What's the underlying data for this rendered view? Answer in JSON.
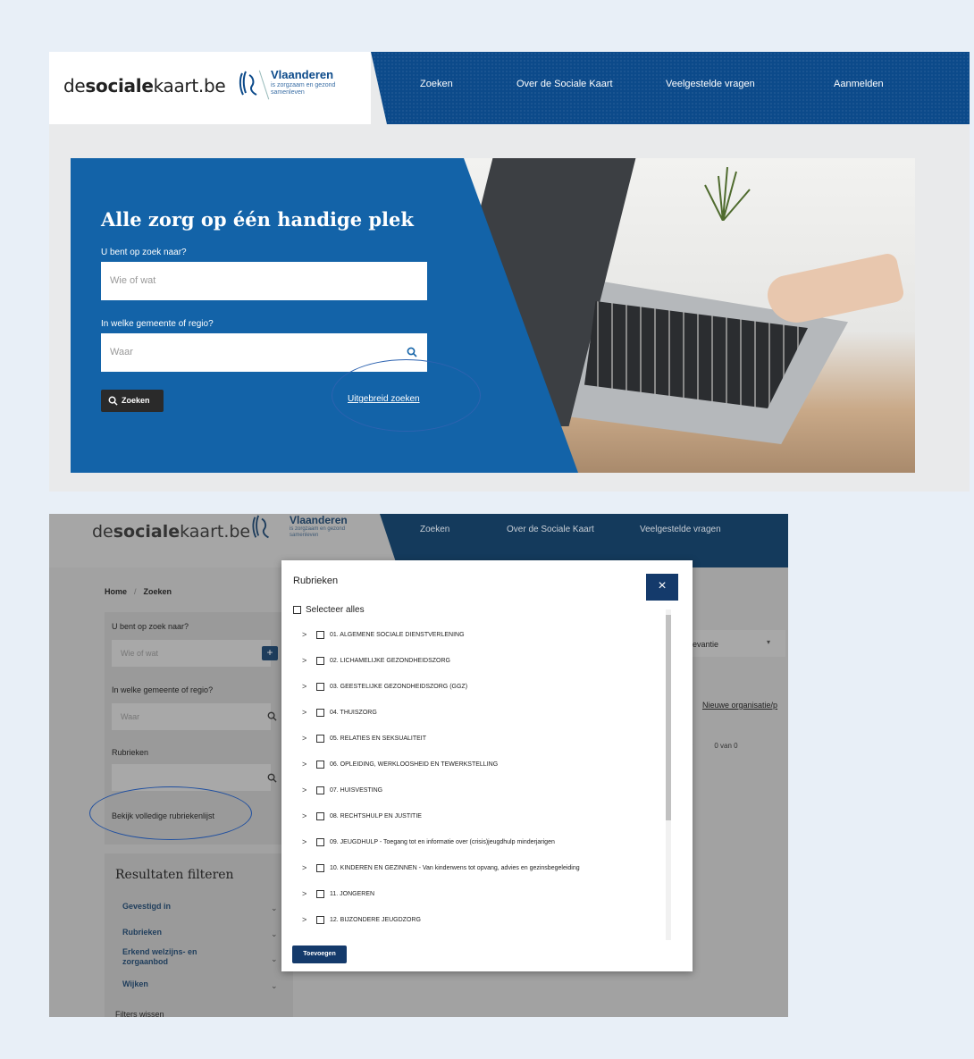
{
  "top": {
    "brand": {
      "prefix": "de",
      "bold": "sociale",
      "suffix": "kaart.be"
    },
    "logo": {
      "title": "Vlaanderen",
      "subtitle": "is zorgzaam en gezond samenleven",
      "icon": "lion-icon"
    },
    "nav": [
      "Zoeken",
      "Over de Sociale Kaart",
      "Veelgestelde vragen",
      "Aanmelden"
    ],
    "hero": {
      "title": "Alle zorg op één handige plek",
      "what_label": "U bent op zoek naar?",
      "what_placeholder": "Wie of wat",
      "where_label": "In welke gemeente of regio?",
      "where_placeholder": "Waar",
      "search_button": "Zoeken",
      "advanced_link": "Uitgebreid zoeken"
    }
  },
  "bottom": {
    "brand": {
      "prefix": "de",
      "bold": "sociale",
      "suffix": "kaart.be"
    },
    "logo": {
      "title": "Vlaanderen",
      "subtitle": "is zorgzaam en gezond samenleven"
    },
    "nav": [
      "Zoeken",
      "Over de Sociale Kaart",
      "Veelgestelde vragen"
    ],
    "breadcrumb": [
      "Home",
      "Zoeken"
    ],
    "sidebar": {
      "what_label": "U bent op zoek naar?",
      "what_placeholder": "Wie of wat",
      "where_label": "In welke gemeente of regio?",
      "where_placeholder": "Waar",
      "rubrieken_label": "Rubrieken",
      "rubrieken_link": "Bekijk volledige rubriekenlijst"
    },
    "filters": {
      "title": "Resultaten filteren",
      "items": [
        "Gevestigd in",
        "Rubrieken",
        "Erkend welzijns- en zorgaanbod",
        "Wijken"
      ],
      "clear": "Filters wissen"
    },
    "sort_value": "levantie",
    "new_org_link": "Nieuwe organisatie/p",
    "pager_text": "0 van 0",
    "modal": {
      "title": "Rubrieken",
      "close": "×",
      "select_all": "Selecteer alles",
      "items": [
        "01. ALGEMENE SOCIALE DIENSTVERLENING",
        "02. LICHAMELIJKE GEZONDHEIDSZORG",
        "03. GEESTELIJKE GEZONDHEIDSZORG (GGZ)",
        "04. THUISZORG",
        "05. RELATIES EN SEKSUALITEIT",
        "06. OPLEIDING, WERKLOOSHEID EN TEWERKSTELLING",
        "07. HUISVESTING",
        "08. RECHTSHULP EN JUSTITIE",
        "09. JEUGDHULP - Toegang tot en informatie over (crisis)jeugdhulp minderjarigen",
        "10. KINDEREN EN GEZINNEN - Van kinderwens tot opvang, advies en gezinsbegeleiding",
        "11. JONGEREN",
        "12. BIJZONDERE JEUGDZORG"
      ],
      "add_button": "Toevoegen"
    }
  }
}
